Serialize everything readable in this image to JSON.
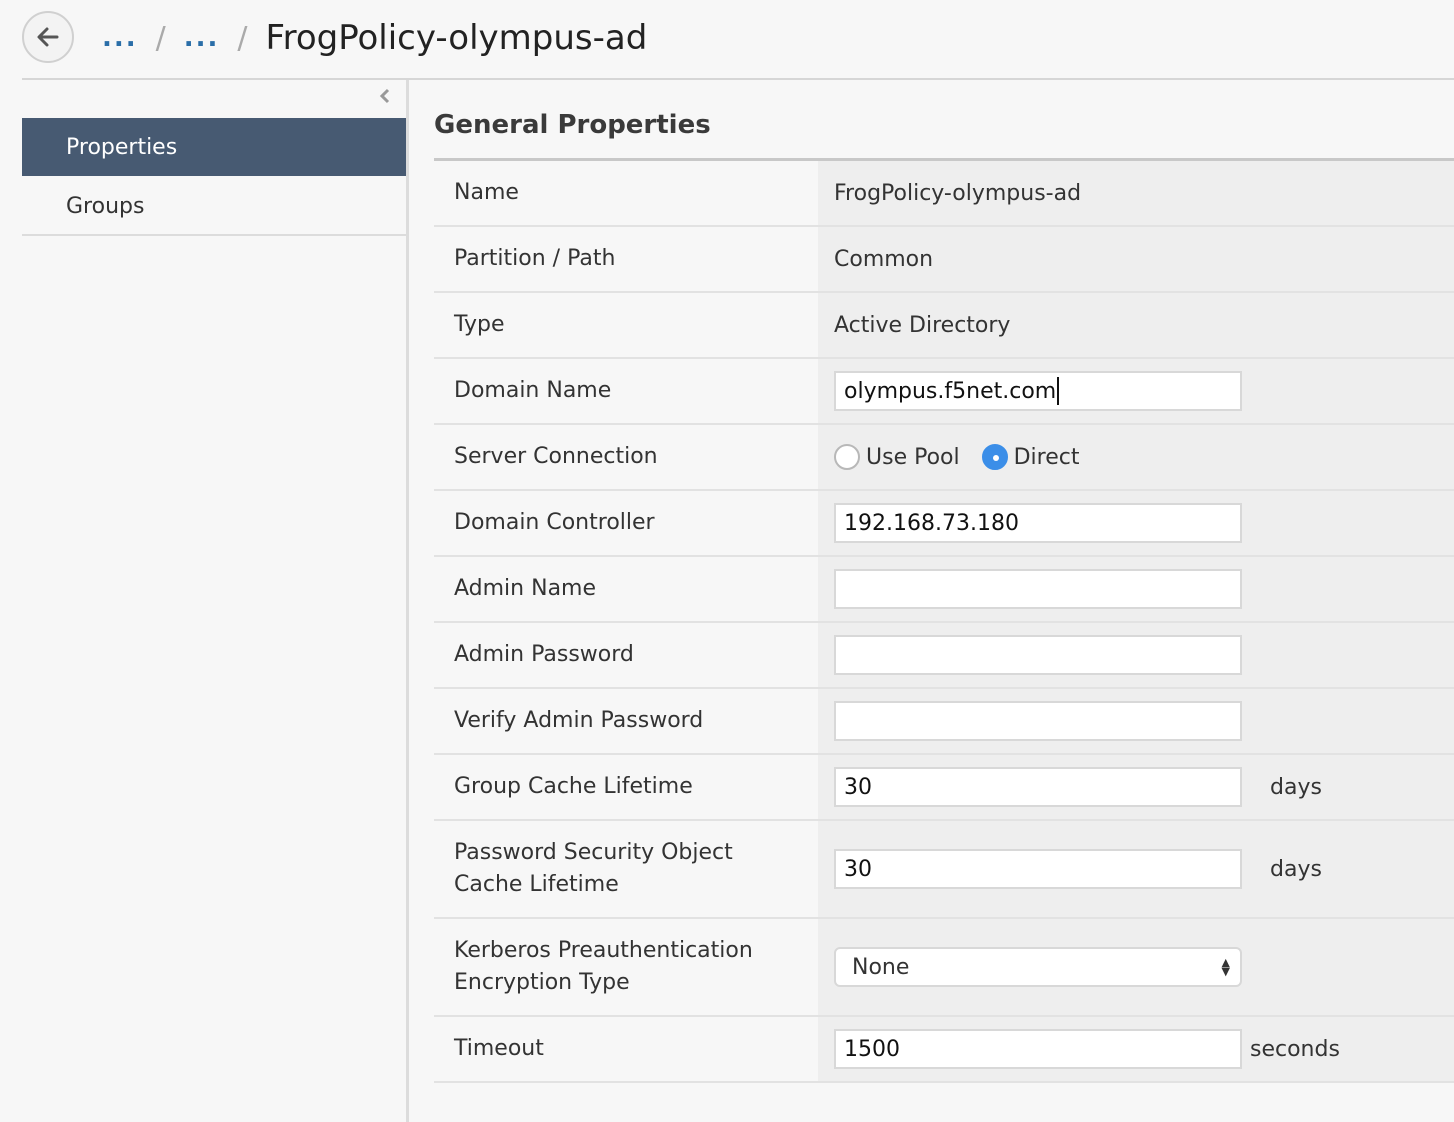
{
  "breadcrumb": {
    "crumb1": "...",
    "sep": "/",
    "crumb2": "...",
    "title": "FrogPolicy-olympus-ad"
  },
  "sidebar": {
    "items": [
      {
        "label": "Properties"
      },
      {
        "label": "Groups"
      }
    ]
  },
  "main": {
    "section_title": "General Properties",
    "fields": {
      "name": {
        "label": "Name",
        "value": "FrogPolicy-olympus-ad"
      },
      "partition": {
        "label": "Partition / Path",
        "value": "Common"
      },
      "type": {
        "label": "Type",
        "value": "Active Directory"
      },
      "domain_name": {
        "label": "Domain Name",
        "value": "olympus.f5net.com"
      },
      "server_connection": {
        "label": "Server Connection",
        "option_pool": "Use Pool",
        "option_direct": "Direct",
        "selected": "Direct"
      },
      "domain_controller": {
        "label": "Domain Controller",
        "value": "192.168.73.180"
      },
      "admin_name": {
        "label": "Admin Name",
        "value": ""
      },
      "admin_password": {
        "label": "Admin Password",
        "value": ""
      },
      "verify_admin_password": {
        "label": "Verify Admin Password",
        "value": ""
      },
      "group_cache": {
        "label": "Group Cache Lifetime",
        "value": "30",
        "unit": "days"
      },
      "pso_cache": {
        "label_line1": "Password Security Object",
        "label_line2": "Cache Lifetime",
        "value": "30",
        "unit": "days"
      },
      "kerberos": {
        "label_line1": "Kerberos Preauthentication",
        "label_line2": "Encryption Type",
        "value": "None"
      },
      "timeout": {
        "label": "Timeout",
        "value": "1500",
        "unit": "seconds"
      }
    }
  },
  "colors": {
    "sidebar_active": "#475a72",
    "link": "#2a6ea8",
    "radio_selected": "#3b8ee8"
  }
}
